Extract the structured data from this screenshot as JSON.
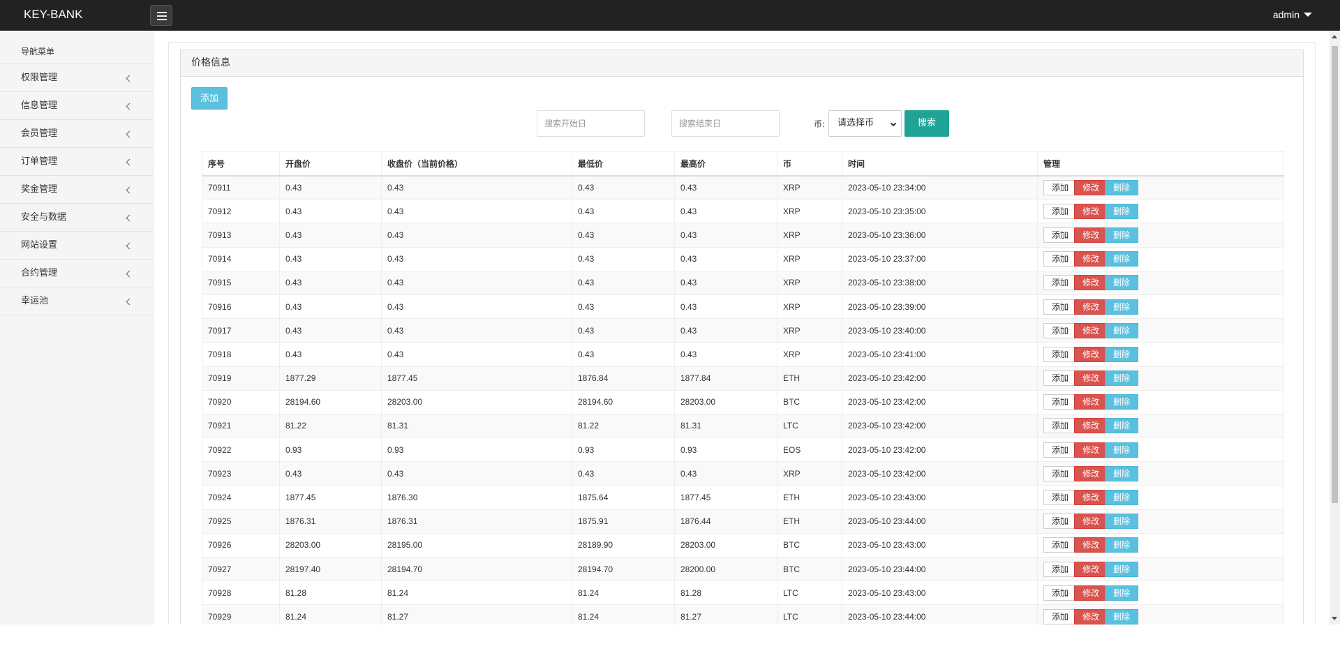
{
  "header": {
    "brand": "KEY-BANK",
    "user": "admin",
    "menu_icon": "hamburger-icon"
  },
  "sidebar": {
    "heading": "导航菜单",
    "items": [
      {
        "label": "权限管理"
      },
      {
        "label": "信息管理"
      },
      {
        "label": "会员管理"
      },
      {
        "label": "订单管理"
      },
      {
        "label": "奖金管理"
      },
      {
        "label": "安全与数据"
      },
      {
        "label": "网站设置"
      },
      {
        "label": "合约管理"
      },
      {
        "label": "幸运池"
      }
    ]
  },
  "panel": {
    "title": "价格信息",
    "add_label": "添加",
    "search": {
      "start_placeholder": "搜索开始日",
      "end_placeholder": "搜索结束日",
      "coin_label": "币:",
      "coin_selected": "请选择币",
      "button": "搜索"
    }
  },
  "table": {
    "headers": [
      "序号",
      "开盘价",
      "收盘价（当前价格）",
      "最低价",
      "最高价",
      "币",
      "时间",
      "管理"
    ],
    "actions": {
      "add": "添加",
      "edit": "修改",
      "delete": "删除"
    },
    "rows": [
      [
        "70911",
        "0.43",
        "0.43",
        "0.43",
        "0.43",
        "XRP",
        "2023-05-10 23:34:00"
      ],
      [
        "70912",
        "0.43",
        "0.43",
        "0.43",
        "0.43",
        "XRP",
        "2023-05-10 23:35:00"
      ],
      [
        "70913",
        "0.43",
        "0.43",
        "0.43",
        "0.43",
        "XRP",
        "2023-05-10 23:36:00"
      ],
      [
        "70914",
        "0.43",
        "0.43",
        "0.43",
        "0.43",
        "XRP",
        "2023-05-10 23:37:00"
      ],
      [
        "70915",
        "0.43",
        "0.43",
        "0.43",
        "0.43",
        "XRP",
        "2023-05-10 23:38:00"
      ],
      [
        "70916",
        "0.43",
        "0.43",
        "0.43",
        "0.43",
        "XRP",
        "2023-05-10 23:39:00"
      ],
      [
        "70917",
        "0.43",
        "0.43",
        "0.43",
        "0.43",
        "XRP",
        "2023-05-10 23:40:00"
      ],
      [
        "70918",
        "0.43",
        "0.43",
        "0.43",
        "0.43",
        "XRP",
        "2023-05-10 23:41:00"
      ],
      [
        "70919",
        "1877.29",
        "1877.45",
        "1876.84",
        "1877.84",
        "ETH",
        "2023-05-10 23:42:00"
      ],
      [
        "70920",
        "28194.60",
        "28203.00",
        "28194.60",
        "28203.00",
        "BTC",
        "2023-05-10 23:42:00"
      ],
      [
        "70921",
        "81.22",
        "81.31",
        "81.22",
        "81.31",
        "LTC",
        "2023-05-10 23:42:00"
      ],
      [
        "70922",
        "0.93",
        "0.93",
        "0.93",
        "0.93",
        "EOS",
        "2023-05-10 23:42:00"
      ],
      [
        "70923",
        "0.43",
        "0.43",
        "0.43",
        "0.43",
        "XRP",
        "2023-05-10 23:42:00"
      ],
      [
        "70924",
        "1877.45",
        "1876.30",
        "1875.64",
        "1877.45",
        "ETH",
        "2023-05-10 23:43:00"
      ],
      [
        "70925",
        "1876.31",
        "1876.31",
        "1875.91",
        "1876.44",
        "ETH",
        "2023-05-10 23:44:00"
      ],
      [
        "70926",
        "28203.00",
        "28195.00",
        "28189.90",
        "28203.00",
        "BTC",
        "2023-05-10 23:43:00"
      ],
      [
        "70927",
        "28197.40",
        "28194.70",
        "28194.70",
        "28200.00",
        "BTC",
        "2023-05-10 23:44:00"
      ],
      [
        "70928",
        "81.28",
        "81.24",
        "81.24",
        "81.28",
        "LTC",
        "2023-05-10 23:43:00"
      ],
      [
        "70929",
        "81.24",
        "81.27",
        "81.24",
        "81.27",
        "LTC",
        "2023-05-10 23:44:00"
      ]
    ]
  }
}
